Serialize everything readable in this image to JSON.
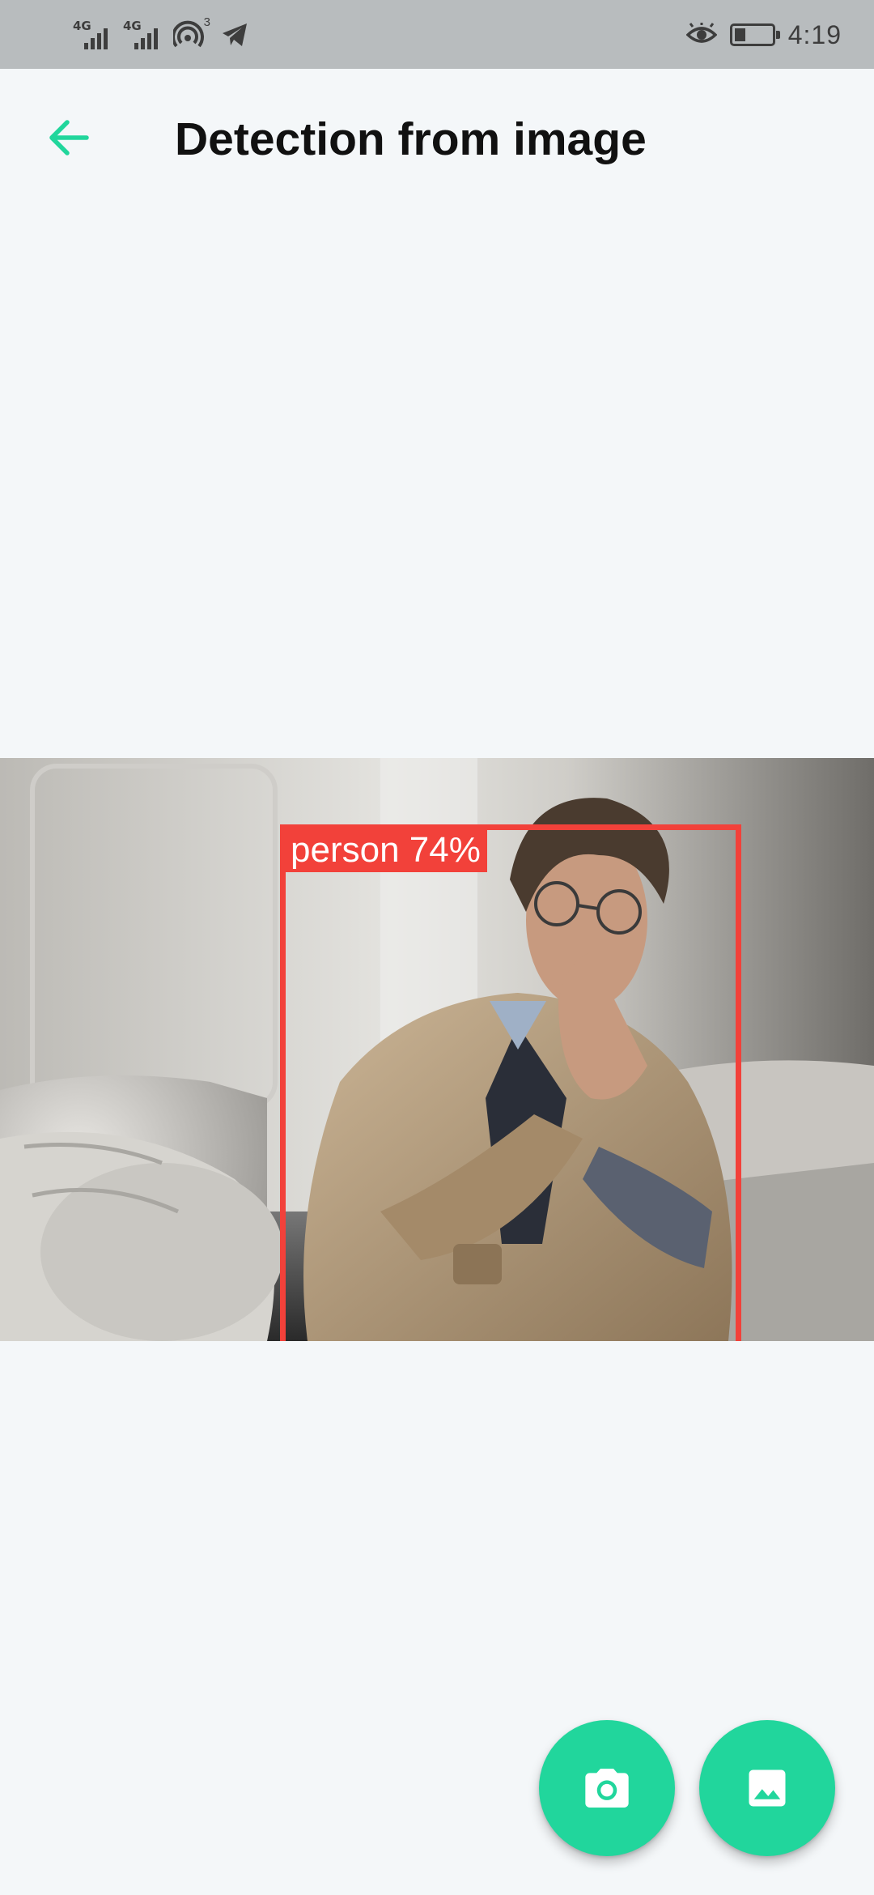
{
  "status_bar": {
    "signal_1_label": "4G",
    "signal_2_label": "4G",
    "hotspot_count": "3",
    "battery_level": 0.3,
    "time": "4:19",
    "icons": [
      "signal-icon",
      "signal-icon",
      "hotspot-icon",
      "telegram-icon",
      "eye-icon",
      "battery-icon"
    ]
  },
  "app_bar": {
    "title": "Detection from image",
    "back_icon": "arrow-left-icon"
  },
  "detection": {
    "label": "person",
    "confidence": "74%",
    "label_text": "person 74%",
    "box_color": "#f2413a"
  },
  "actions": {
    "camera_icon": "camera-icon",
    "gallery_icon": "image-icon",
    "accent_color": "#21d69c"
  }
}
